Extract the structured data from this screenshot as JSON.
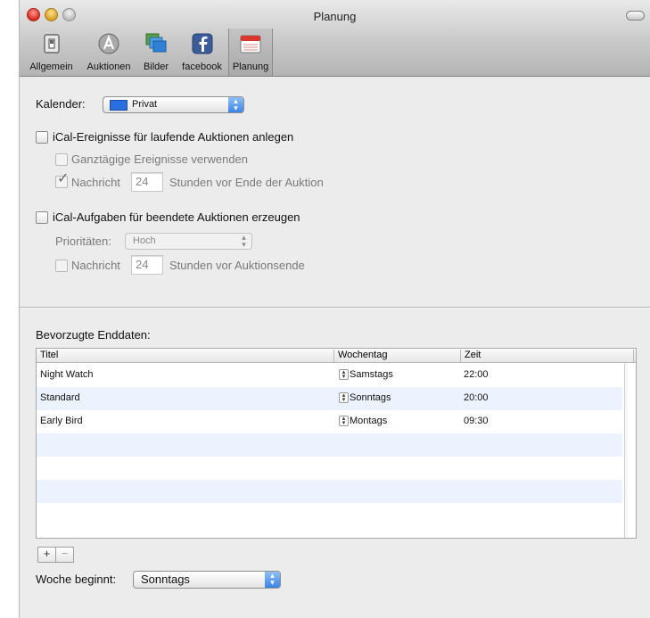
{
  "window": {
    "title": "Planung"
  },
  "toolbar": {
    "items": [
      {
        "label": "Allgemein",
        "icon": "switch-icon"
      },
      {
        "label": "Auktionen",
        "icon": "app-store-a-icon"
      },
      {
        "label": "Bilder",
        "icon": "pictures-icon"
      },
      {
        "label": "facebook",
        "icon": "facebook-icon"
      },
      {
        "label": "Planung",
        "icon": "calendar-icon",
        "selected": true
      }
    ]
  },
  "calendar": {
    "label": "Kalender:",
    "value": "Privat",
    "color": "#2a6fe0"
  },
  "events": {
    "label": "iCal-Ereignisse für laufende Auktionen anlegen",
    "checked": false,
    "allday_label": "Ganztägige Ereignisse verwenden",
    "allday_checked": false,
    "notice_label": "Nachricht",
    "notice_checked": true,
    "notice_value": "24",
    "notice_suffix": "Stunden vor Ende der Auktion"
  },
  "tasks": {
    "label": "iCal-Aufgaben für beendete Auktionen erzeugen",
    "checked": false,
    "priority_label": "Prioritäten:",
    "priority_value": "Hoch",
    "notice_label": "Nachricht",
    "notice_checked": false,
    "notice_value": "24",
    "notice_suffix": "Stunden vor Auktionsende"
  },
  "end_dates": {
    "label": "Bevorzugte Enddaten:",
    "columns": [
      "Titel",
      "Wochentag",
      "Zeit"
    ],
    "rows": [
      {
        "title": "Night Watch",
        "weekday": "Samstags",
        "time": "22:00"
      },
      {
        "title": "Standard",
        "weekday": "Sonntags",
        "time": "20:00"
      },
      {
        "title": "Early Bird",
        "weekday": "Montags",
        "time": "09:30"
      }
    ],
    "add": "+",
    "remove": "−"
  },
  "week": {
    "label": "Woche beginnt:",
    "value": "Sonntags"
  }
}
